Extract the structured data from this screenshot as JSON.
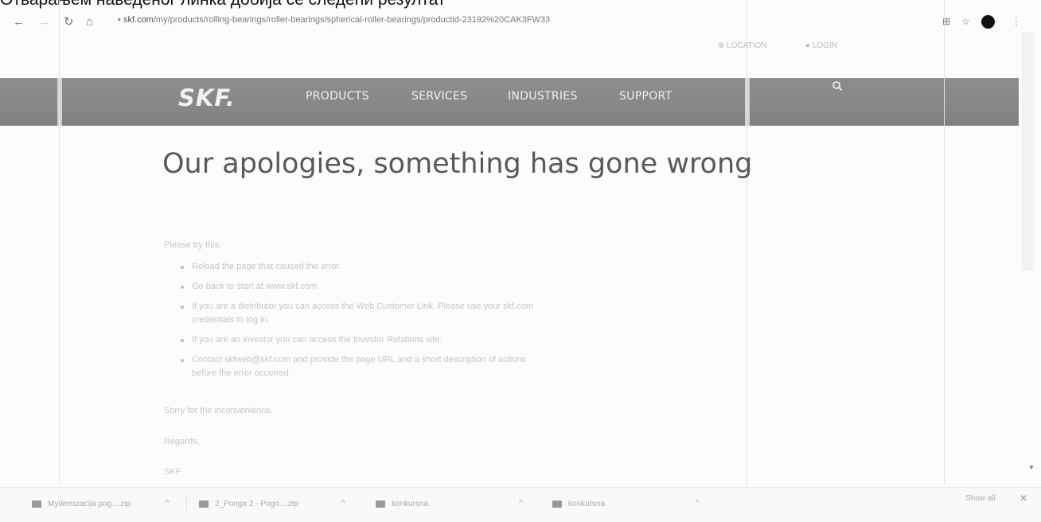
{
  "caption": "Отварањем наведеног линка добија се следећи резултат",
  "browser": {
    "url_scheme_icon": "lock-icon",
    "url_host": "skf.com",
    "url_path": "/my/products/rolling-bearings/roller-bearings/spherical-roller-bearings/productid-23192%20CAK3FW33"
  },
  "utility": {
    "location_label": "LOCATION",
    "login_label": "LOGIN"
  },
  "header": {
    "logo": "SKF.",
    "menu": [
      "PRODUCTS",
      "SERVICES",
      "INDUSTRIES",
      "SUPPORT"
    ]
  },
  "content": {
    "headline": "Our apologies, something has gone wrong",
    "try_label": "Please try this:",
    "bullets": [
      "Reload the page that caused the error.",
      "Go back to start at www.skf.com",
      "If you are a distributor you can access the Web Customer Link. Please use your skf.com",
      "credentials to log in.",
      "If you are an investor you can access the Investor Relations site.",
      "Contact skfweb@skf.com and provide the page URL and a short description of actions",
      "before the error occurred."
    ],
    "sorry": "Sorry for the inconvenience.",
    "regards": "Regards,",
    "signature": "SKF"
  },
  "downloads": {
    "items": [
      "Муdemizacija pog....zip",
      "2_Ponga 2 - Pogo....zip",
      "konkursna",
      "konkursna"
    ],
    "show_all": "Show all"
  }
}
